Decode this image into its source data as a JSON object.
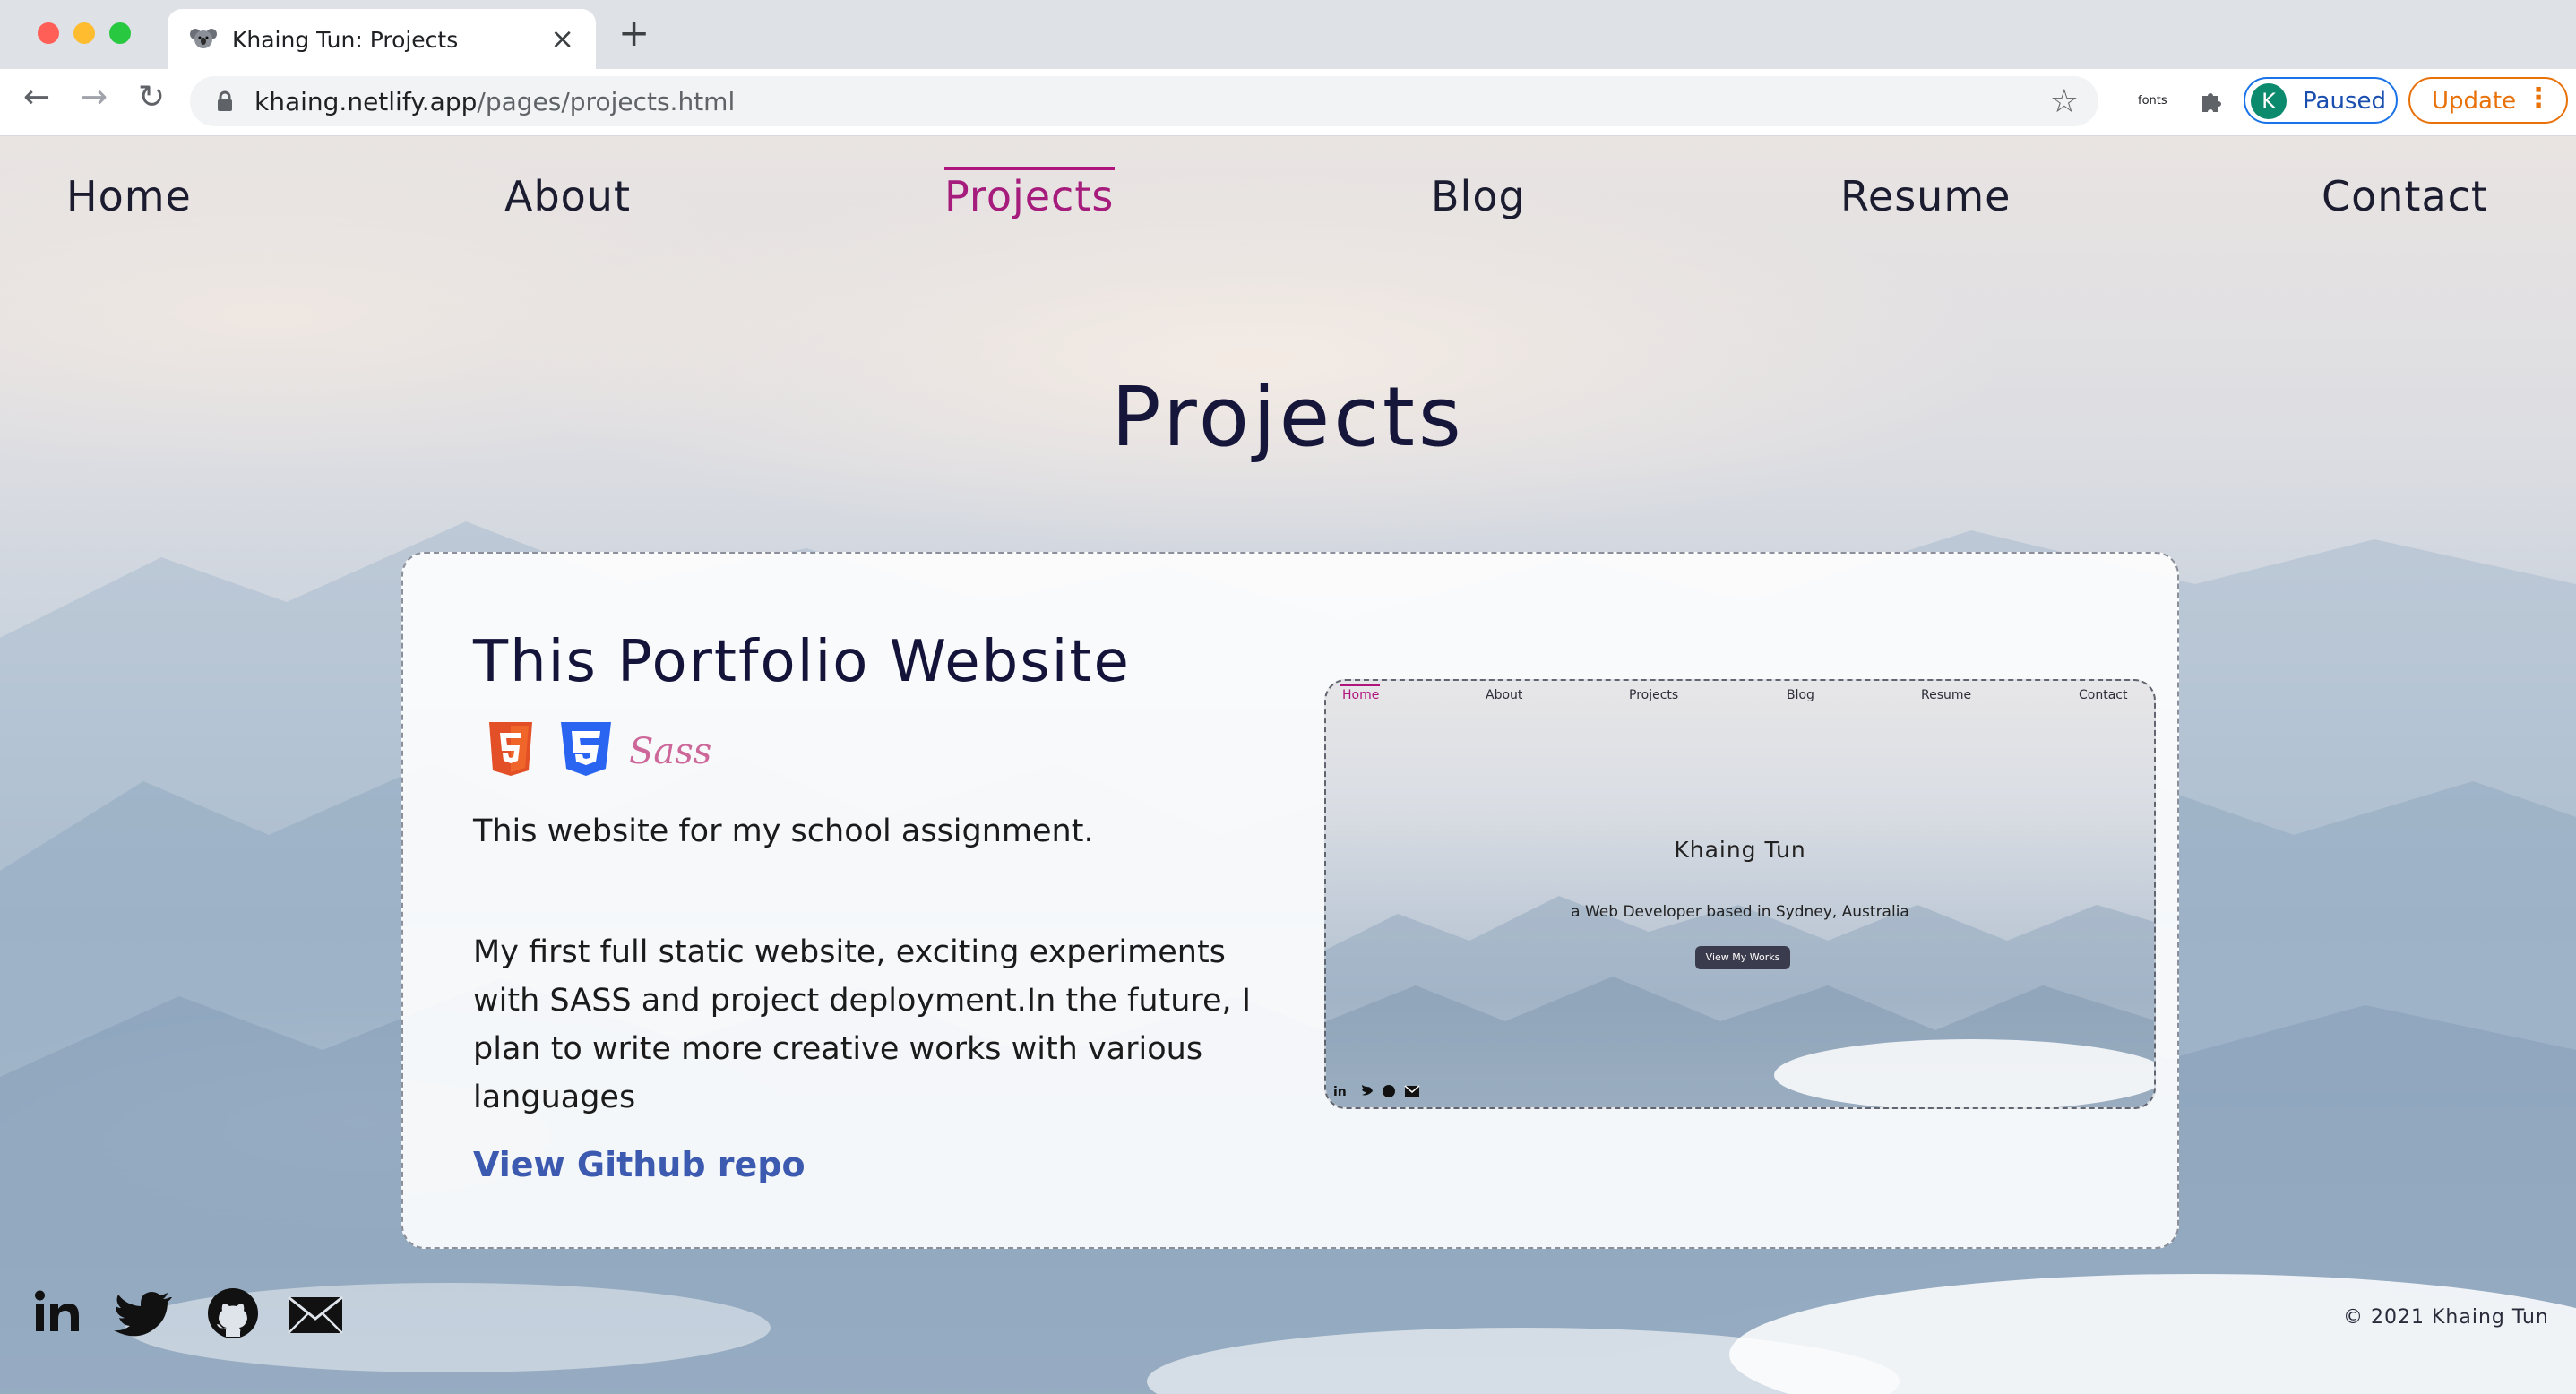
{
  "browser": {
    "tab_title": "Khaing Tun: Projects",
    "url_host": "khaing.netlify.app",
    "url_path": "/pages/projects.html",
    "ext_label": "fonts",
    "profile_initial": "K",
    "profile_status": "Paused",
    "update_label": "Update",
    "colors": {
      "paused": "#1a73e8",
      "update": "#e8710a"
    }
  },
  "nav": {
    "items": [
      "Home",
      "About",
      "Projects",
      "Blog",
      "Resume",
      "Contact"
    ],
    "active": "Projects",
    "active_color": "#a51c7c"
  },
  "page": {
    "title": "Projects"
  },
  "project": {
    "title": "This Portfolio Website",
    "tech_icons": [
      "html5-icon",
      "css3-icon",
      "sass-icon"
    ],
    "description_1": "This website for my school assignment.",
    "description_2": "My first full static website, exciting experiments with SASS and project deployment.In the future, I plan to write more creative works with various languages",
    "repo_link": "View Github repo",
    "preview": {
      "nav": [
        "Home",
        "About",
        "Projects",
        "Blog",
        "Resume",
        "Contact"
      ],
      "name": "Khaing Tun",
      "tagline": "a Web Developer based in Sydney, Australia",
      "button": "View My Works"
    }
  },
  "footer": {
    "social": [
      "linkedin-icon",
      "twitter-icon",
      "github-icon",
      "mail-icon"
    ],
    "copyright": "© 2021 Khaing Tun"
  }
}
